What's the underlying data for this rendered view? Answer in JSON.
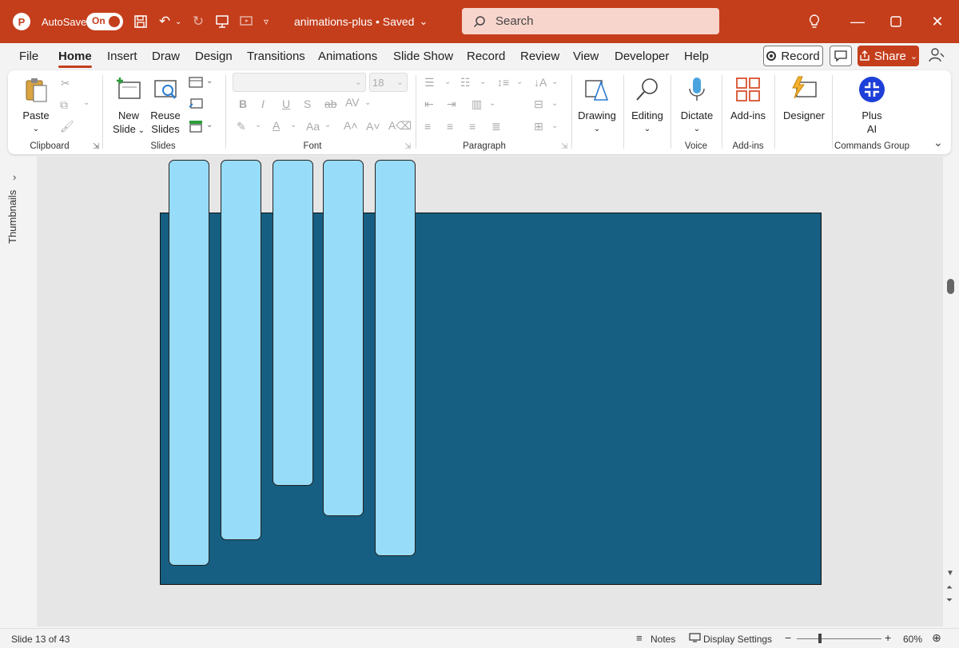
{
  "titlebar": {
    "autosave_label": "AutoSave",
    "autosave_state": "On",
    "doc_title": "animations-plus • Saved",
    "search_placeholder": "Search"
  },
  "tabs": [
    "File",
    "Home",
    "Insert",
    "Draw",
    "Design",
    "Transitions",
    "Animations",
    "Slide Show",
    "Record",
    "Review",
    "View",
    "Developer",
    "Help"
  ],
  "active_tab": "Home",
  "header_actions": {
    "record_label": "Record",
    "share_label": "Share"
  },
  "ribbon": {
    "clipboard": {
      "label": "Clipboard",
      "paste": "Paste"
    },
    "slides": {
      "label": "Slides",
      "new_slide_1": "New",
      "new_slide_2": "Slide",
      "reuse_1": "Reuse",
      "reuse_2": "Slides"
    },
    "font": {
      "label": "Font",
      "font_size": "18"
    },
    "paragraph": {
      "label": "Paragraph"
    },
    "drawing": "Drawing",
    "editing": "Editing",
    "voice": {
      "label": "Voice",
      "dictate": "Dictate"
    },
    "addins": {
      "label": "Add-ins",
      "button": "Add-ins"
    },
    "designer": "Designer",
    "commands": {
      "label": "Commands Group",
      "plus_1": "Plus",
      "plus_2": "AI"
    }
  },
  "left_panel": {
    "label": "Thumbnails"
  },
  "slide": {
    "background": "#165f82",
    "bar_color": "#97dcf8"
  },
  "statusbar": {
    "slide_info": "Slide 13 of 43",
    "notes": "Notes",
    "display_settings": "Display Settings",
    "zoom": "60%"
  },
  "colors": {
    "accent": "#c43e1c"
  }
}
